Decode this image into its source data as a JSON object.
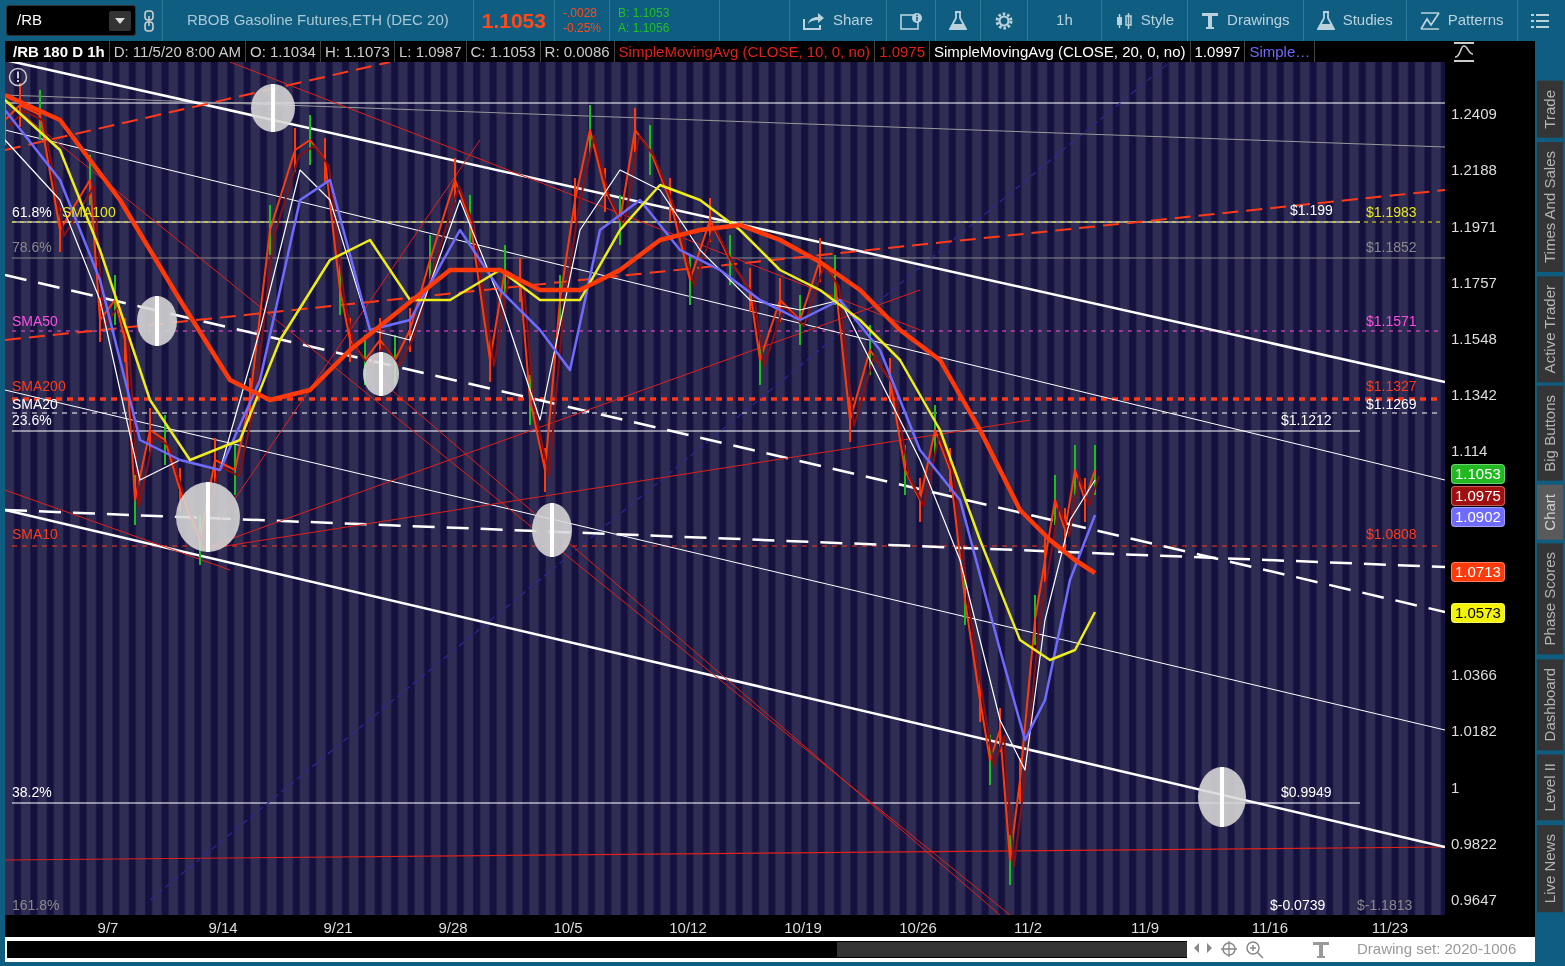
{
  "toolbar": {
    "symbol": "/RB",
    "description": "RBOB Gasoline Futures,ETH (DEC 20)",
    "last": "1.1053",
    "change": "-.0028",
    "change_pct": "-0.25%",
    "bid": "B: 1.1053",
    "ask": "A: 1.1056",
    "buttons": [
      {
        "kind": "share",
        "label": "Share"
      },
      {
        "kind": "info"
      },
      {
        "kind": "flask"
      },
      {
        "kind": "gear"
      },
      {
        "kind": "interval",
        "label": "1h"
      },
      {
        "kind": "style",
        "label": "Style"
      },
      {
        "kind": "drawings",
        "label": "Drawings"
      },
      {
        "kind": "studies",
        "label": "Studies"
      },
      {
        "kind": "patterns",
        "label": "Patterns"
      },
      {
        "kind": "menu"
      }
    ]
  },
  "chart_header": {
    "title": "/RB 180 D 1h",
    "fields": [
      "D: 11/5/20 8:00 AM",
      "O: 1.1034",
      "H: 1.1073",
      "L: 1.0987",
      "C: 1.1053",
      "R: 0.0086"
    ],
    "studies": [
      {
        "name": "SimpleMovingAvg (CLOSE, 10, 0, no)",
        "value": "1.0975",
        "kind": "sma10"
      },
      {
        "name": "SimpleMovingAvg (CLOSE, 20, 0, no)",
        "value": "1.0997",
        "kind": "sma20"
      },
      {
        "name": "Simple…",
        "kind": "sma50"
      }
    ]
  },
  "chart": {
    "left_labels": [
      {
        "text": "61.8%",
        "kind": "fib"
      },
      {
        "text": "SMA100",
        "kind": "sma100"
      },
      {
        "text": "78.6%",
        "kind": "faint"
      },
      {
        "text": "SMA50",
        "kind": "sma50"
      },
      {
        "text": "SMA200",
        "kind": "sma200"
      },
      {
        "text": "SMA20",
        "kind": "sma20"
      },
      {
        "text": "23.6%",
        "kind": "fib"
      },
      {
        "text": "SMA10",
        "kind": "sma10"
      },
      {
        "text": "38.2%",
        "kind": "fib"
      },
      {
        "text": "161.8%",
        "kind": "faint"
      }
    ],
    "right_labels": [
      {
        "text": "$1.199",
        "kind": "fib"
      },
      {
        "text": "$1.1983",
        "kind": "sma100"
      },
      {
        "text": "$1.1852",
        "kind": "faint"
      },
      {
        "text": "$1.1571",
        "kind": "sma50"
      },
      {
        "text": "$1.1327",
        "kind": "sma200"
      },
      {
        "text": "$1.1269",
        "kind": "sma20"
      },
      {
        "text": "$1.1212",
        "kind": "fib"
      },
      {
        "text": "$1.0808",
        "kind": "sma10"
      },
      {
        "text": "$0.9949",
        "kind": "fib"
      },
      {
        "text": "$-0.0739",
        "kind": "fib"
      },
      {
        "text": "$-1.1813",
        "kind": "faint"
      }
    ],
    "price_axis": [
      "1.2409",
      "1.2188",
      "1.1971",
      "1.1757",
      "1.1548",
      "1.1342",
      "1.114",
      "1.0366",
      "1.0182",
      "1",
      "0.9822",
      "0.9647"
    ],
    "price_tags": [
      {
        "text": "1.1053",
        "color": "#22b822"
      },
      {
        "text": "1.0975",
        "color": "#a01010"
      },
      {
        "text": "1.0902",
        "color": "#6f6bff"
      },
      {
        "text": "1.0713",
        "color": "#ff3a0a"
      },
      {
        "text": "1.0573",
        "color": "#f2f20a"
      }
    ],
    "date_axis": [
      "9/7",
      "9/14",
      "9/21",
      "9/28",
      "10/5",
      "10/12",
      "10/19",
      "10/26",
      "11/2",
      "11/9",
      "11/16",
      "11/23"
    ]
  },
  "footer": {
    "drawing_set": "Drawing set: 2020-1006"
  },
  "side_tabs": [
    {
      "label": "Trade",
      "selected": false
    },
    {
      "label": "Times And Sales",
      "selected": false
    },
    {
      "label": "Active Trader",
      "selected": false
    },
    {
      "label": "Big Buttons",
      "selected": false
    },
    {
      "label": "Chart",
      "selected": true
    },
    {
      "label": "Phase Scores",
      "selected": false
    },
    {
      "label": "Dashboard",
      "selected": false
    },
    {
      "label": "Level II",
      "selected": false
    },
    {
      "label": "Live News",
      "selected": false
    }
  ]
}
